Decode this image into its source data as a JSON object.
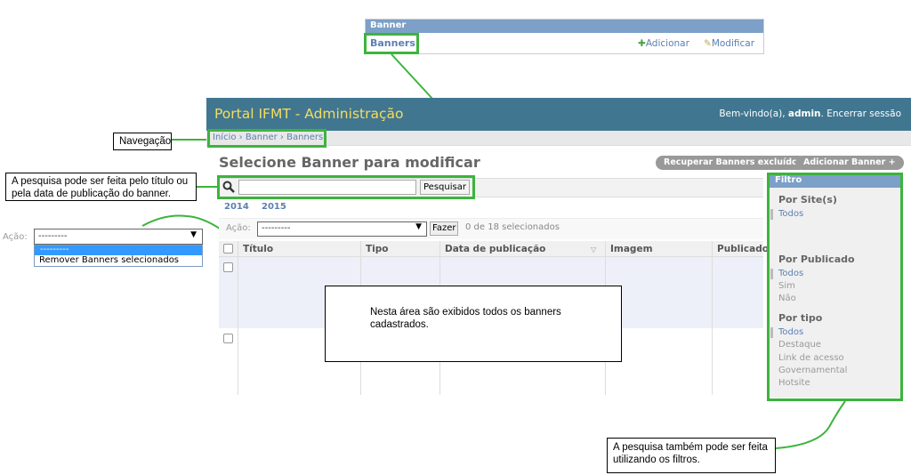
{
  "banner_module": {
    "caption": "Banner",
    "model": "Banners",
    "add": "Adicionar",
    "change": "Modificar"
  },
  "header": {
    "site_title": "Portal IFMT - Administração",
    "welcome": "Bem-vindo(a), ",
    "user": "admin",
    "logout": ". Encerrar sessão"
  },
  "breadcrumbs": "Início › Banner › Banners",
  "page": {
    "title": "Selecione Banner para modificar",
    "recover_button": "Recuperar Banners excluído",
    "add_button": "Adicionar Banner +",
    "search_button": "Pesquisar",
    "dates": [
      "2014",
      "2015"
    ]
  },
  "actions": {
    "label": "Ação:",
    "selected": "---------",
    "go": "Fazer",
    "counter": "0 de 18 selecionados"
  },
  "table": {
    "columns": [
      "Título",
      "Tipo",
      "Data de publicação",
      "Imagem",
      "Publicado"
    ]
  },
  "filter": {
    "title": "Filtro",
    "site_heading": "Por Site(s)",
    "site_options": [
      "Todos"
    ],
    "published_heading": "Por Publicado",
    "published_options": [
      "Todos",
      "Sim",
      "Não"
    ],
    "type_heading": "Por tipo",
    "type_options": [
      "Todos",
      "Destaque",
      "Link de acesso",
      "Governamental",
      "Hotsite"
    ]
  },
  "left_dropdown": {
    "label": "Ação:",
    "selected": "---------",
    "options": [
      "---------",
      "Remover Banners selecionados"
    ]
  },
  "annotations": {
    "navigation": "Navegação",
    "search": "A pesquisa pode ser feita pelo título ou pela data de publicação do banner.",
    "area": "Nesta área são exibidos todos os banners cadastrados.",
    "filters": "A pesquisa também pode ser feita utilizando os filtros."
  }
}
